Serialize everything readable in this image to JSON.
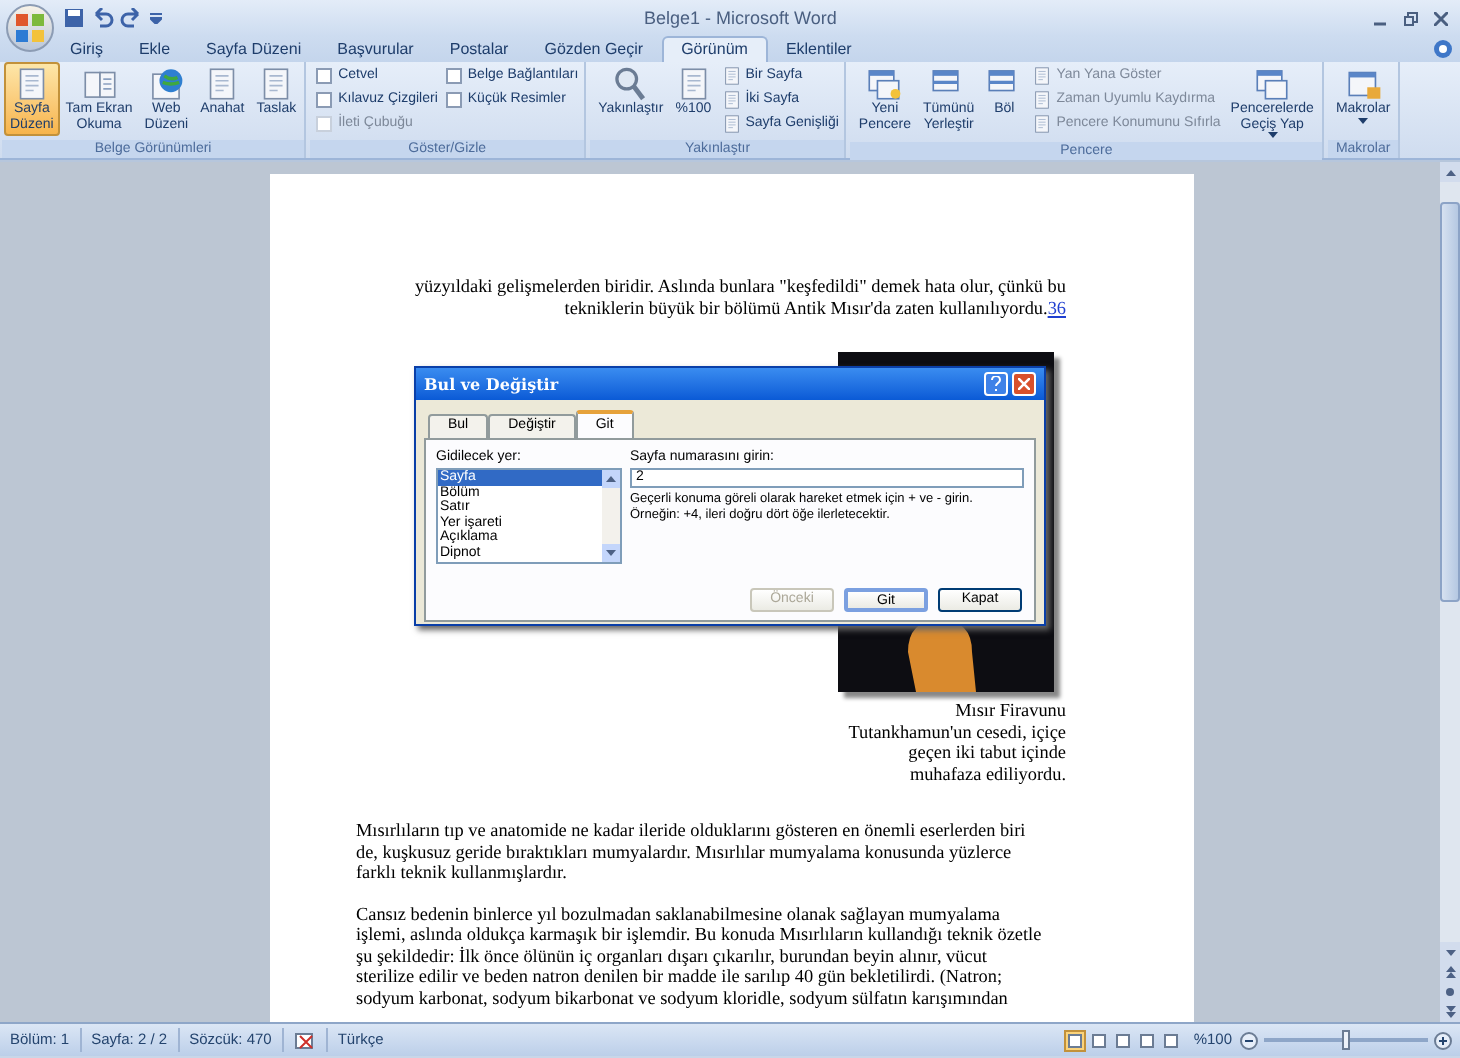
{
  "window": {
    "title": "Belge1 - Microsoft Word"
  },
  "tabs": [
    {
      "label": "Giriş",
      "selected": false
    },
    {
      "label": "Ekle",
      "selected": false
    },
    {
      "label": "Sayfa Düzeni",
      "selected": false
    },
    {
      "label": "Başvurular",
      "selected": false
    },
    {
      "label": "Postalar",
      "selected": false
    },
    {
      "label": "Gözden Geçir",
      "selected": false
    },
    {
      "label": "Görünüm",
      "selected": true
    },
    {
      "label": "Eklentiler",
      "selected": false
    }
  ],
  "ribbon": [
    {
      "label": "Belge Görünümleri",
      "items": [
        {
          "kind": "large",
          "label": "Sayfa\nDüzeni",
          "selected": true
        },
        {
          "kind": "large",
          "label": "Tam Ekran\nOkuma",
          "selected": false
        },
        {
          "kind": "large",
          "label": "Web\nDüzeni",
          "selected": false
        },
        {
          "kind": "large",
          "label": "Anahat",
          "selected": false
        },
        {
          "kind": "large",
          "label": "Taslak",
          "selected": false
        }
      ]
    },
    {
      "label": "Göster/Gizle",
      "items": [
        {
          "kind": "stack",
          "entries": [
            {
              "kind": "check",
              "label": "Cetvel",
              "checked": false,
              "disabled": false
            },
            {
              "kind": "check",
              "label": "Kılavuz Çizgileri",
              "checked": false,
              "disabled": false
            },
            {
              "kind": "check",
              "label": "İleti Çubuğu",
              "checked": false,
              "disabled": true
            }
          ]
        },
        {
          "kind": "stack",
          "entries": [
            {
              "kind": "check",
              "label": "Belge Bağlantıları",
              "checked": false,
              "disabled": false
            },
            {
              "kind": "check",
              "label": "Küçük Resimler",
              "checked": false,
              "disabled": false
            }
          ]
        }
      ]
    },
    {
      "label": "Yakınlaştır",
      "items": [
        {
          "kind": "large",
          "label": "Yakınlaştır",
          "selected": false
        },
        {
          "kind": "large",
          "label": "%100",
          "selected": false
        },
        {
          "kind": "stack",
          "entries": [
            {
              "kind": "small",
              "label": "Bir Sayfa",
              "disabled": false
            },
            {
              "kind": "small",
              "label": "İki Sayfa",
              "disabled": false
            },
            {
              "kind": "small",
              "label": "Sayfa Genişliği",
              "disabled": false
            }
          ]
        }
      ]
    },
    {
      "label": "Pencere",
      "items": [
        {
          "kind": "large",
          "label": "Yeni\nPencere",
          "selected": false
        },
        {
          "kind": "large",
          "label": "Tümünü\nYerleştir",
          "selected": false
        },
        {
          "kind": "large",
          "label": "Böl",
          "selected": false
        },
        {
          "kind": "stack",
          "entries": [
            {
              "kind": "small",
              "label": "Yan Yana Göster",
              "disabled": true
            },
            {
              "kind": "small",
              "label": "Zaman Uyumlu Kaydırma",
              "disabled": true
            },
            {
              "kind": "small",
              "label": "Pencere Konumunu Sıfırla",
              "disabled": true
            }
          ]
        },
        {
          "kind": "large",
          "label": "Pencerelerde\nGeçiş Yap",
          "selected": false,
          "dropdown": true
        }
      ]
    },
    {
      "label": "Makrolar",
      "items": [
        {
          "kind": "large",
          "label": "Makrolar",
          "selected": false,
          "dropdown": true
        }
      ]
    }
  ],
  "document": {
    "top_paragraph": {
      "lines": [
        "yüzyıldaki gelişmelerden biridir. Aslında bunlara \"keşfedildi\" demek hata olur, çünkü bu",
        "tekniklerin büyük bir bölümü Antik Mısır'da zaten kullanılıyordu."
      ],
      "footnote": "36"
    },
    "caption": [
      "Mısır Firavunu",
      "Tutankhamun'un cesedi, içiçe",
      "geçen iki tabut içinde",
      "muhafaza ediliyordu."
    ],
    "paragraphs": [
      {
        "lines": [
          "Mısırlıların tıp ve anatomide ne kadar ileride olduklarını gösteren en önemli eserlerden biri",
          "de, kuşkusuz geride bıraktıkları mumyalardır. Mısırlılar mumyalama konusunda yüzlerce",
          "farklı teknik kullanmışlardır."
        ]
      },
      {
        "lines": [
          "Cansız bedenin binlerce yıl bozulmadan saklanabilmesine olanak sağlayan mumyalama",
          "işlemi, aslında oldukça karmaşık bir işlemdir. Bu konuda Mısırlıların kullandığı teknik özetle",
          "şu şekildedir: İlk önce ölünün iç organları dışarı çıkarılır, burundan beyin alınır, vücut",
          "sterilize edilir ve beden natron denilen bir madde ile sarılıp 40 gün bekletilirdi. (Natron;",
          "sodyum karbonat, sodyum bikarbonat ve sodyum kloridle, sodyum sülfatın karışımından"
        ]
      }
    ]
  },
  "dialog": {
    "title": "Bul ve Değiştir",
    "tabs": [
      {
        "label": "Bul",
        "selected": false
      },
      {
        "label": "Değiştir",
        "selected": false
      },
      {
        "label": "Git",
        "selected": true
      }
    ],
    "list_label": "Gidilecek yer:",
    "list_items": [
      {
        "label": "Sayfa",
        "selected": true
      },
      {
        "label": "Bölüm",
        "selected": false
      },
      {
        "label": "Satır",
        "selected": false
      },
      {
        "label": "Yer işareti",
        "selected": false
      },
      {
        "label": "Açıklama",
        "selected": false
      },
      {
        "label": "Dipnot",
        "selected": false
      }
    ],
    "field_label": "Sayfa numarasını girin:",
    "field_value": "2",
    "hint": "Geçerli konuma göreli olarak hareket etmek için + ve - girin. Örneğin: +4, ileri doğru dört öğe ilerletecektir.",
    "buttons": [
      {
        "label": "Önceki",
        "disabled": true,
        "focused": false
      },
      {
        "label": "Git",
        "disabled": false,
        "focused": true
      },
      {
        "label": "Kapat",
        "disabled": false,
        "focused": false
      }
    ]
  },
  "status_bar": {
    "items": [
      "Bölüm: 1",
      "Sayfa: 2 / 2",
      "Sözcük: 470"
    ],
    "language": "Türkçe",
    "views": [
      {
        "selected": true
      },
      {
        "selected": false
      },
      {
        "selected": false
      },
      {
        "selected": false
      },
      {
        "selected": false
      }
    ],
    "zoom": "%100",
    "level": 0.5
  }
}
